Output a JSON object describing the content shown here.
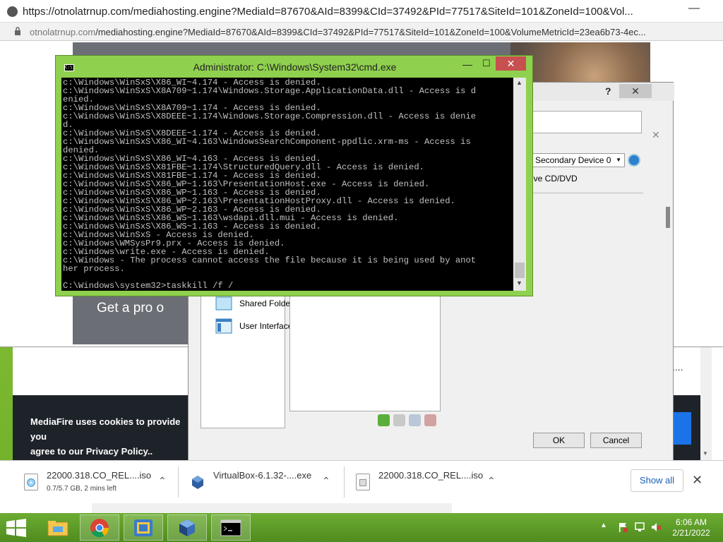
{
  "popup": {
    "title": "https://otnolatrnup.com/mediahosting.engine?MediaId=87670&AId=8399&CId=37492&PId=77517&SiteId=101&ZoneId=100&Vol...",
    "minimize": "—",
    "url_domain": "otnolatrnup.com",
    "url_path": "/mediahosting.engine?MediaId=87670&AId=8399&CId=37492&PId=77517&SiteId=101&ZoneId=100&VolumeMetricId=23ea6b73-4ec...",
    "banner_text": "Get a pro o"
  },
  "mediafire": {
    "cookie_text": "MediaFire uses cookies to provide you ... agree to our Privacy Policy..",
    "cookie_line1": "MediaFire uses cookies to provide you",
    "cookie_line2": "agree to our Privacy Policy..",
    "button_fragment": "t",
    "dots": "....",
    "scroll_down": "▼"
  },
  "vbox_dialog": {
    "help": "?",
    "close": "✕",
    "name_close": "✕",
    "dropdown_value": "Secondary Device 0",
    "dropdown_arrow": "▼",
    "live_cd": "ive CD/DVD",
    "sidebar_items": [
      {
        "label": "Shared Folders",
        "icon": "shared-folders-icon"
      },
      {
        "label": "User Interface",
        "icon": "user-interface-icon"
      }
    ],
    "ok": "OK",
    "cancel": "Cancel"
  },
  "cmd": {
    "icon_text": "C:\\",
    "title": "Administrator: C:\\Windows\\System32\\cmd.exe",
    "minimize": "—",
    "maximize": "☐",
    "close": "✕",
    "lines": [
      "c:\\Windows\\WinSxS\\X86_WI~4.174 - Access is denied.",
      "c:\\Windows\\WinSxS\\X8A709~1.174\\Windows.Storage.ApplicationData.dll - Access is d",
      "enied.",
      "c:\\Windows\\WinSxS\\X8A709~1.174 - Access is denied.",
      "c:\\Windows\\WinSxS\\X8DEEE~1.174\\Windows.Storage.Compression.dll - Access is denie",
      "d.",
      "c:\\Windows\\WinSxS\\X8DEEE~1.174 - Access is denied.",
      "c:\\Windows\\WinSxS\\X86_WI~4.163\\WindowsSearchComponent-ppdlic.xrm-ms - Access is",
      "denied.",
      "c:\\Windows\\WinSxS\\X86_WI~4.163 - Access is denied.",
      "c:\\Windows\\WinSxS\\X81FBE~1.174\\StructuredQuery.dll - Access is denied.",
      "c:\\Windows\\WinSxS\\X81FBE~1.174 - Access is denied.",
      "c:\\Windows\\WinSxS\\X86_WP~1.163\\PresentationHost.exe - Access is denied.",
      "c:\\Windows\\WinSxS\\X86_WP~1.163 - Access is denied.",
      "c:\\Windows\\WinSxS\\X86_WP~2.163\\PresentationHostProxy.dll - Access is denied.",
      "c:\\Windows\\WinSxS\\X86_WP~2.163 - Access is denied.",
      "c:\\Windows\\WinSxS\\X86_WS~1.163\\wsdapi.dll.mui - Access is denied.",
      "c:\\Windows\\WinSxS\\X86_WS~1.163 - Access is denied.",
      "c:\\Windows\\WinSxS - Access is denied.",
      "c:\\Windows\\WMSysPr9.prx - Access is denied.",
      "c:\\Windows\\write.exe - Access is denied.",
      "c:\\Windows - The process cannot access the file because it is being used by anot",
      "her process.",
      "",
      "C:\\Windows\\system32>taskkill /f /"
    ],
    "scroll_up": "▲",
    "scroll_down": "▼"
  },
  "downloads": {
    "items": [
      {
        "name": "22000.318.CO_REL....iso",
        "status": "0.7/5.7 GB, 2 mins left",
        "icon": "disc-file-icon"
      },
      {
        "name": "VirtualBox-6.1.32-....exe",
        "status": "",
        "icon": "virtualbox-file-icon"
      },
      {
        "name": "22000.318.CO_REL....iso",
        "status": "",
        "icon": "file-icon"
      }
    ],
    "chevron": "⌃",
    "show_all": "Show all",
    "close": "✕"
  },
  "taskbar": {
    "apps": [
      {
        "name": "file-explorer",
        "icon": "folder-icon",
        "active": false
      },
      {
        "name": "chrome",
        "icon": "chrome-icon",
        "active": true
      },
      {
        "name": "virtualbox-manager",
        "icon": "vbox-manager-icon",
        "active": true
      },
      {
        "name": "virtualbox",
        "icon": "virtualbox-icon",
        "active": true
      },
      {
        "name": "command-prompt",
        "icon": "cmd-icon",
        "active": true
      }
    ],
    "tray_arrow": "▲",
    "time": "6:06 AM",
    "date": "2/21/2022"
  },
  "colors": {
    "cmd_frame": "#8fd14f",
    "cmd_close": "#c75050",
    "taskbar": "#5c9a28",
    "link_blue": "#1a5fb4"
  }
}
